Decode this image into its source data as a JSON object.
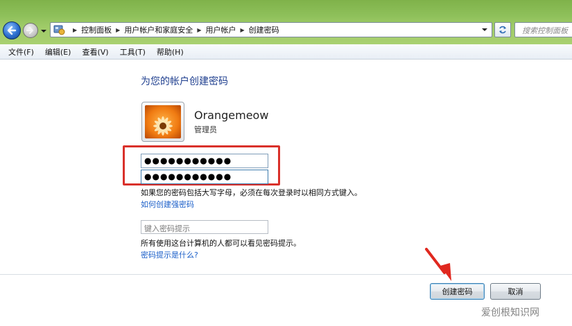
{
  "window": {
    "breadcrumb": [
      "控制面板",
      "用户帐户和家庭安全",
      "用户帐户",
      "创建密码"
    ],
    "search_placeholder": "搜索控制面板"
  },
  "menubar": {
    "items": [
      "文件(F)",
      "编辑(E)",
      "查看(V)",
      "工具(T)",
      "帮助(H)"
    ]
  },
  "main": {
    "heading": "为您的帐户创建密码",
    "user": {
      "name": "Orangemeow",
      "role": "管理员"
    },
    "new_password_value": "●●●●●●●●●●●",
    "confirm_password_value": "●●●●●●●●●●●",
    "caps_note": "如果您的密码包括大写字母，必须在每次登录时以相同方式键入。",
    "strong_password_link": "如何创建强密码",
    "hint_placeholder": "键入密码提示",
    "hint_note": "所有使用这台计算机的人都可以看见密码提示。",
    "hint_link": "密码提示是什么?"
  },
  "buttons": {
    "create": "创建密码",
    "cancel": "取消"
  },
  "watermark": "爱创根知识网",
  "colors": {
    "link": "#1a5ec8",
    "heading": "#1f3f8f",
    "highlight_box": "#d9302a",
    "annotation_arrow": "#e0281f",
    "chrome_green": "#8ec05a"
  },
  "icons": {
    "back": "back-arrow-icon",
    "forward": "forward-arrow-icon",
    "refresh": "refresh-icon",
    "control_panel": "control-panel-icon",
    "avatar": "orange-flower-avatar"
  }
}
